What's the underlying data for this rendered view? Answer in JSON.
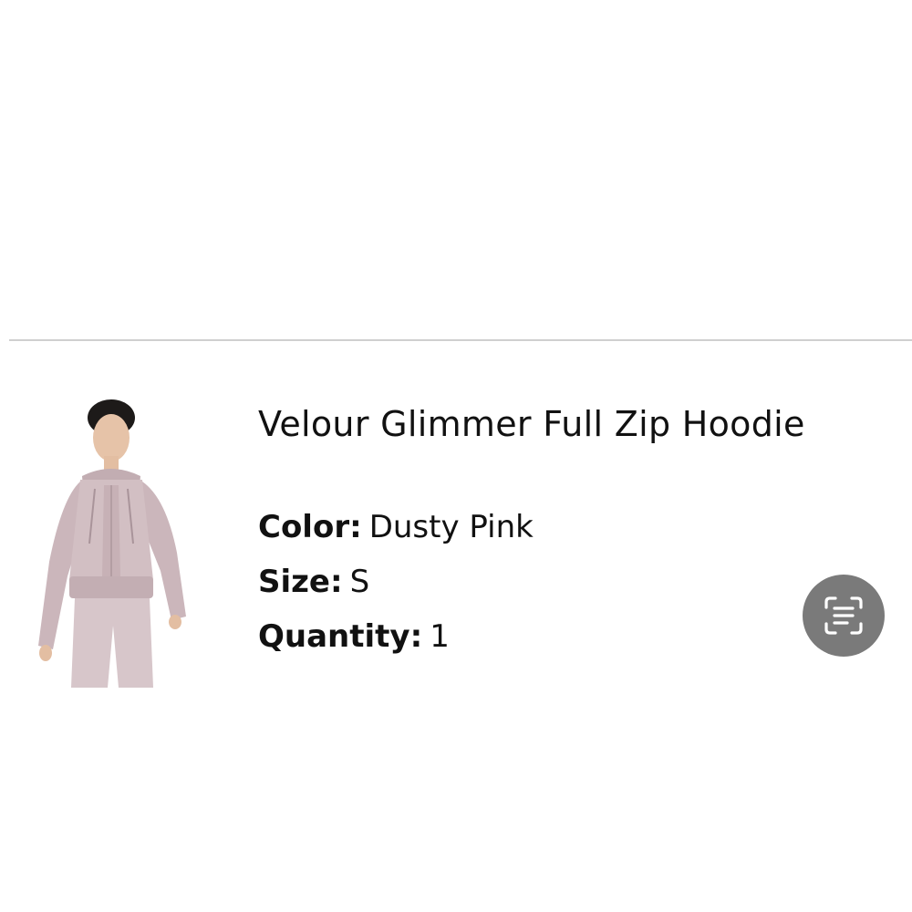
{
  "product": {
    "title": "Velour Glimmer Full Zip Hoodie",
    "image_alt": "model wearing dusty pink velour zip hoodie",
    "attributes": {
      "color_label": "Color:",
      "color_value": "Dusty Pink",
      "size_label": "Size:",
      "size_value": "S",
      "quantity_label": "Quantity:",
      "quantity_value": "1"
    },
    "swatch_color": "#cdb9bd"
  },
  "overlay": {
    "icon": "text-scan-icon",
    "button_color": "#7a7a7a"
  },
  "colors": {
    "divider": "#cfcfcf",
    "text": "#111111",
    "background": "#ffffff"
  }
}
